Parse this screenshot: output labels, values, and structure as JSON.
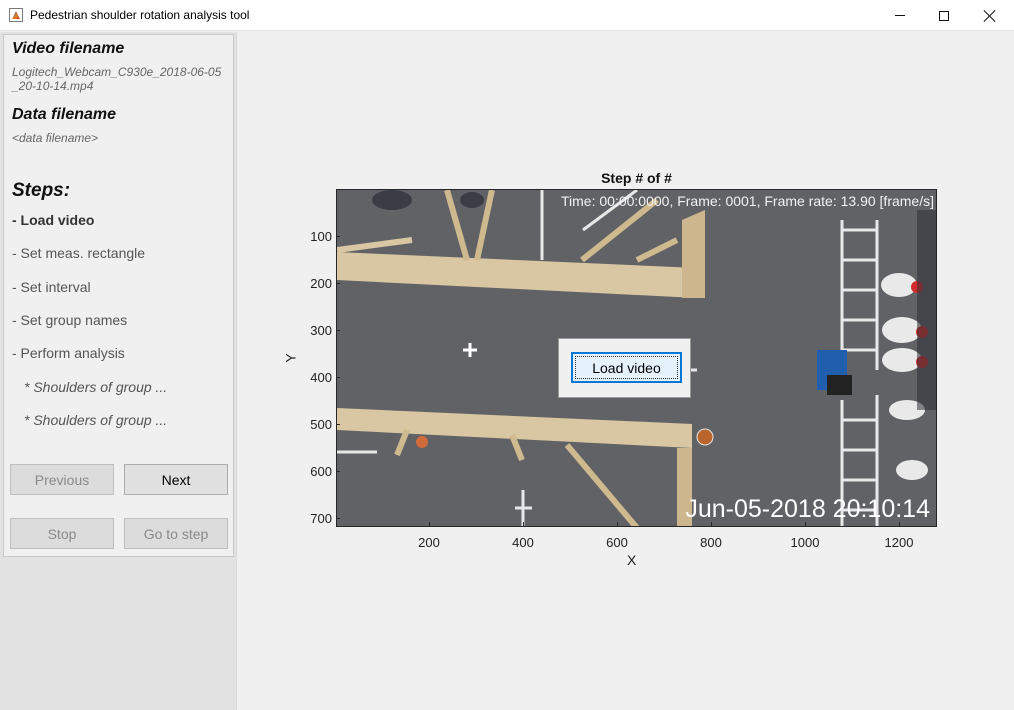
{
  "window": {
    "title": "Pedestrian shoulder rotation analysis tool",
    "controls": [
      "minimize",
      "maximize",
      "close"
    ]
  },
  "left_panel": {
    "video_heading": "Video filename",
    "video_filename": "Logitech_Webcam_C930e_2018-06-05_20-10-14.mp4",
    "data_heading": "Data filename",
    "data_filename": "<data filename>",
    "steps_heading": "Steps:",
    "steps": [
      {
        "label": "- Load video",
        "active": true
      },
      {
        "label": "- Set meas. rectangle",
        "active": false
      },
      {
        "label": "- Set interval",
        "active": false
      },
      {
        "label": "- Set group names",
        "active": false
      },
      {
        "label": "- Perform analysis",
        "active": false
      },
      {
        "label": "* Shoulders of group ...",
        "active": false
      },
      {
        "label": "* Shoulders of group ...",
        "active": false
      }
    ],
    "buttons": {
      "previous": "Previous",
      "next": "Next",
      "stop": "Stop",
      "go_to_step": "Go to step"
    }
  },
  "plot": {
    "title": "Step # of #",
    "overlay_info": "Time: 00:00:0000, Frame: 0001, Frame rate: 13.90 [frame/s]",
    "timestamp_overlay": "Jun-05-2018 20:10:14",
    "xlabel": "X",
    "ylabel": "Y",
    "xticks": [
      "200",
      "400",
      "600",
      "800",
      "1000",
      "1200"
    ],
    "yticks": [
      "100",
      "200",
      "300",
      "400",
      "500",
      "600",
      "700"
    ],
    "xlim": [
      0,
      1280
    ],
    "ylim": [
      0,
      720
    ],
    "load_video_button": "Load video"
  },
  "colors": {
    "floor": "#5e5f62",
    "barrier": "#d8c4a0",
    "active_button_border": "#0078d7"
  }
}
